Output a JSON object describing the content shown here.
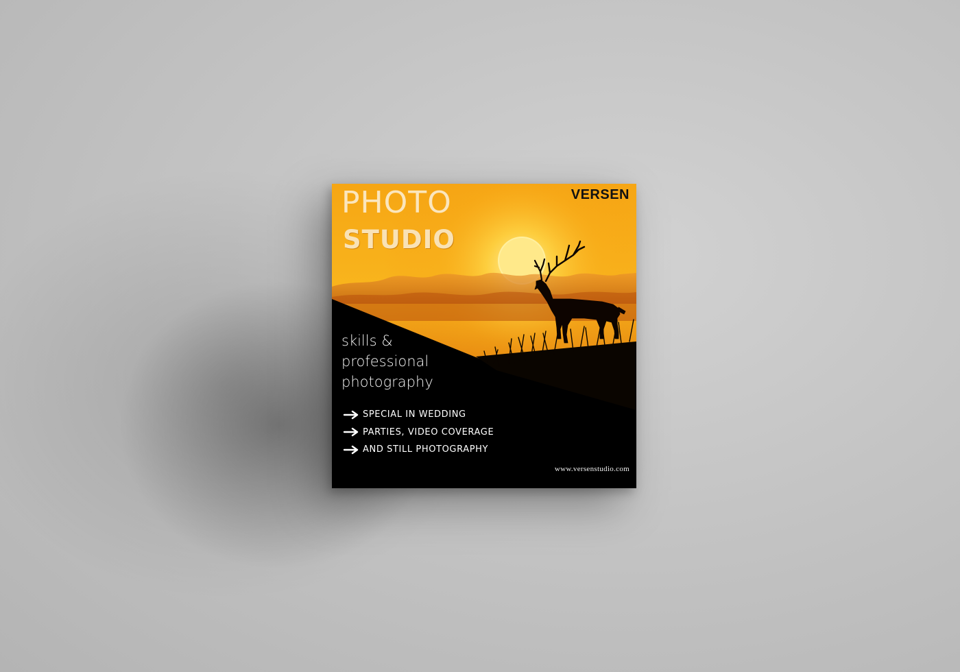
{
  "card": {
    "headline_line1": "PHOTO",
    "headline_line2": "STUDIO",
    "brand": "VERSEN",
    "tagline": [
      "skills &",
      "professional",
      "photography"
    ],
    "services": [
      "SPECIAL IN WEDDING",
      "PARTIES, VIDEO COVERAGE",
      "AND STILL PHOTOGRAPHY"
    ],
    "website": "www.versenstudio.com"
  },
  "colors": {
    "backdrop": "#c4c4c4",
    "sky_top": "#f7b21c",
    "sky_bottom": "#b8480c",
    "sun": "#ffe889",
    "dark_panel": "#000000",
    "headline": "#fbe6bd",
    "brand_text": "#111111"
  },
  "icons": {
    "service_bullet": "arrow-right-icon",
    "photo_subject": "deer-silhouette"
  }
}
